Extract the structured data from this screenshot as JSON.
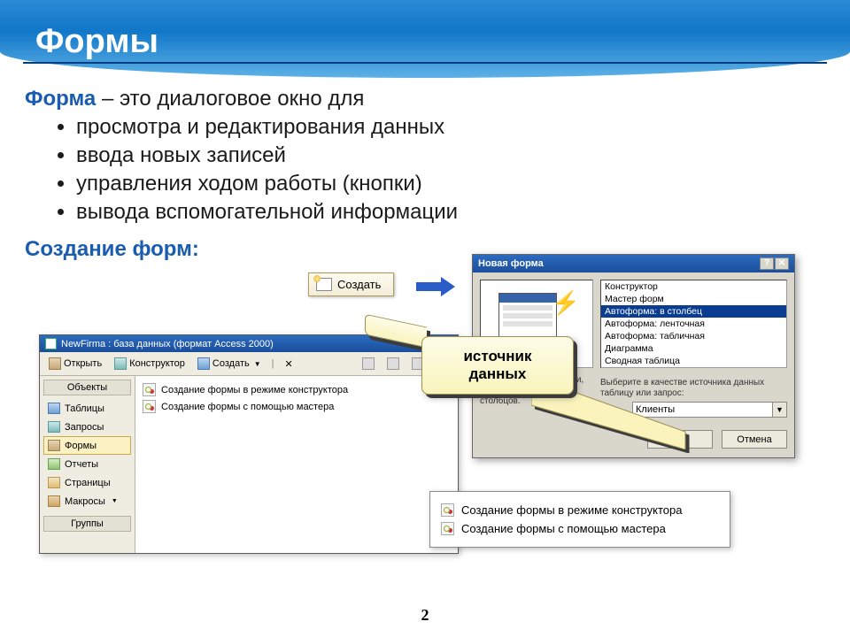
{
  "page": {
    "title": "Формы",
    "number": "2"
  },
  "def": {
    "term": "Форма",
    "rest": " – это диалоговое окно для",
    "bullets": [
      "просмотра и редактирования данных",
      "ввода новых записей",
      "управления ходом работы (кнопки)",
      "вывода вспомогательной информации"
    ],
    "sub": "Создание форм:"
  },
  "create_btn": "Создать",
  "db": {
    "title": "NewFirma : база данных (формат Access 2000)",
    "toolbar": {
      "open": "Открыть",
      "design": "Конструктор",
      "new": "Создать"
    },
    "side_head": "Объекты",
    "side": [
      "Таблицы",
      "Запросы",
      "Формы",
      "Отчеты",
      "Страницы",
      "Макросы"
    ],
    "side_groups": "Группы",
    "main": [
      "Создание формы в режиме конструктора",
      "Создание формы с помощью мастера"
    ]
  },
  "dlg": {
    "title": "Новая форма",
    "list": [
      "Конструктор",
      "Мастер форм",
      "Автоформа: в столбец",
      "Автоформа: ленточная",
      "Автоформа: табличная",
      "Диаграмма",
      "Сводная таблица"
    ],
    "desc": "ческое создание полями, женными в один ько столбцов.",
    "src_label": "Выберите в качестве источника данных таблицу или запрос:",
    "src_value": "Клиенты",
    "ok": "OK",
    "cancel": "Отмена"
  },
  "callout": {
    "l1": "источник",
    "l2": "данных"
  },
  "popup": [
    "Создание формы в режиме конструктора",
    "Создание формы с помощью мастера"
  ]
}
